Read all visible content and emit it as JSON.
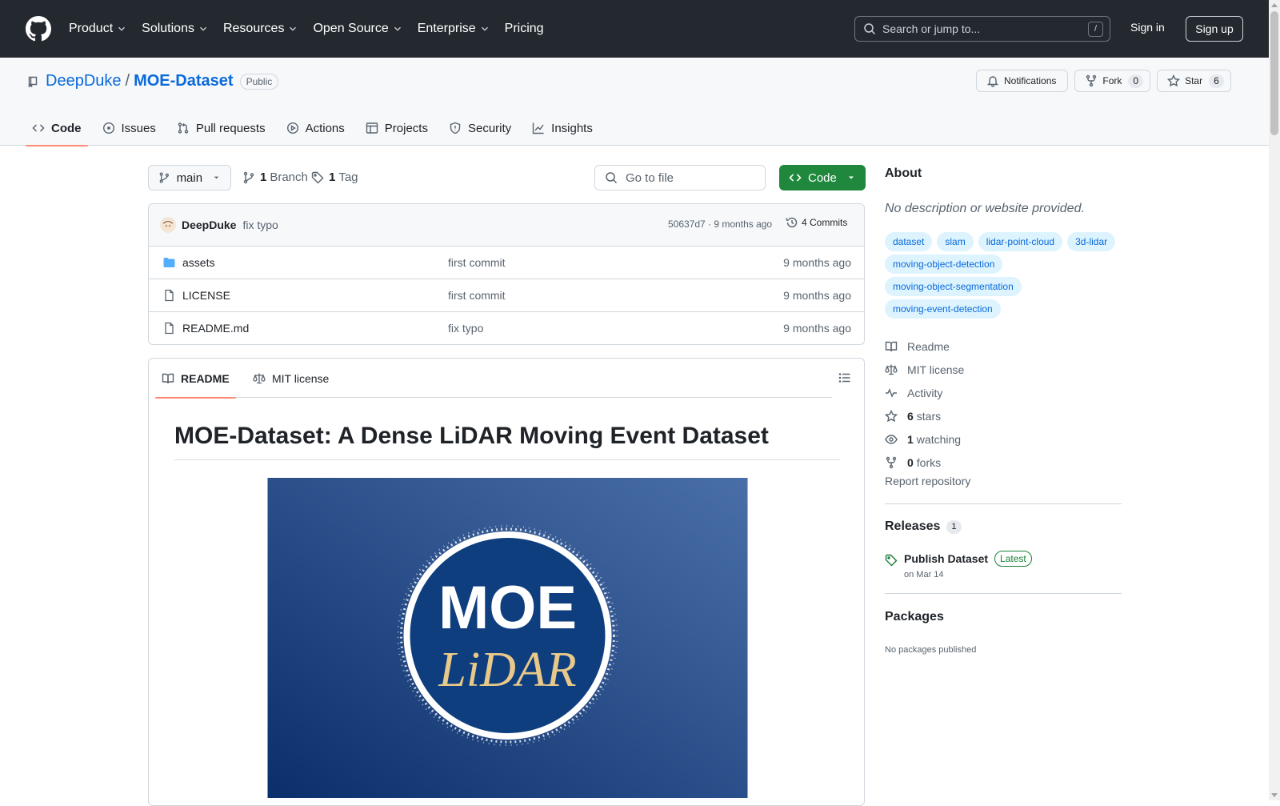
{
  "header": {
    "nav": [
      {
        "label": "Product",
        "dropdown": true
      },
      {
        "label": "Solutions",
        "dropdown": true
      },
      {
        "label": "Resources",
        "dropdown": true
      },
      {
        "label": "Open Source",
        "dropdown": true
      },
      {
        "label": "Enterprise",
        "dropdown": true
      },
      {
        "label": "Pricing",
        "dropdown": false
      }
    ],
    "search_placeholder": "Search or jump to...",
    "search_shortcut": "/",
    "sign_in": "Sign in",
    "sign_up": "Sign up"
  },
  "repo": {
    "owner": "DeepDuke",
    "separator": "/",
    "name": "MOE-Dataset",
    "visibility": "Public",
    "notifications_label": "Notifications",
    "fork_label": "Fork",
    "fork_count": "0",
    "star_label": "Star",
    "star_count": "6"
  },
  "tabs": [
    {
      "label": "Code",
      "icon": "code-icon",
      "active": true
    },
    {
      "label": "Issues",
      "icon": "issue-icon",
      "active": false
    },
    {
      "label": "Pull requests",
      "icon": "pull-request-icon",
      "active": false
    },
    {
      "label": "Actions",
      "icon": "play-icon",
      "active": false
    },
    {
      "label": "Projects",
      "icon": "table-icon",
      "active": false
    },
    {
      "label": "Security",
      "icon": "shield-icon",
      "active": false
    },
    {
      "label": "Insights",
      "icon": "graph-icon",
      "active": false
    }
  ],
  "toolbar": {
    "branch": "main",
    "branch_count": "1",
    "branch_label": "Branch",
    "tag_count": "1",
    "tag_label": "Tag",
    "go_to_file": "Go to file",
    "code_button": "Code"
  },
  "latest_commit": {
    "author": "DeepDuke",
    "message": "fix typo",
    "meta": "50637d7 · 9 months ago",
    "commits": "4 Commits"
  },
  "files": [
    {
      "name": "assets",
      "type": "folder",
      "message": "first commit",
      "date": "9 months ago"
    },
    {
      "name": "LICENSE",
      "type": "file",
      "message": "first commit",
      "date": "9 months ago"
    },
    {
      "name": "README.md",
      "type": "file",
      "message": "fix typo",
      "date": "9 months ago"
    }
  ],
  "readme": {
    "tab_readme": "README",
    "tab_license": "MIT license",
    "title": "MOE-Dataset: A Dense LiDAR Moving Event Dataset",
    "banner_text_1": "MOE",
    "banner_text_2": "LiDAR"
  },
  "about": {
    "heading": "About",
    "description": "No description or website provided.",
    "topics": [
      "dataset",
      "slam",
      "lidar-point-cloud",
      "3d-lidar",
      "moving-object-detection",
      "moving-object-segmentation",
      "moving-event-detection"
    ],
    "links": [
      {
        "icon": "book-icon",
        "count": "",
        "label": "Readme"
      },
      {
        "icon": "law-icon",
        "count": "",
        "label": "MIT license"
      },
      {
        "icon": "pulse-icon",
        "count": "",
        "label": "Activity"
      },
      {
        "icon": "star-icon",
        "count": "6",
        "label": "stars"
      },
      {
        "icon": "eye-icon",
        "count": "1",
        "label": "watching"
      },
      {
        "icon": "fork-icon",
        "count": "0",
        "label": "forks"
      }
    ],
    "report": "Report repository"
  },
  "releases": {
    "heading": "Releases",
    "count": "1",
    "latest_title": "Publish Dataset",
    "latest_badge": "Latest",
    "latest_date": "on Mar 14"
  },
  "packages": {
    "heading": "Packages",
    "empty_text": "No packages published"
  },
  "colors": {
    "header_bg": "#24292f",
    "link": "#0969da",
    "primary_button": "#1f883d",
    "active_tab_underline": "#fd8c73",
    "topic_bg": "#ddf4ff",
    "banner_bg": "#0e3a7a",
    "banner_accent": "#e8c98a"
  }
}
